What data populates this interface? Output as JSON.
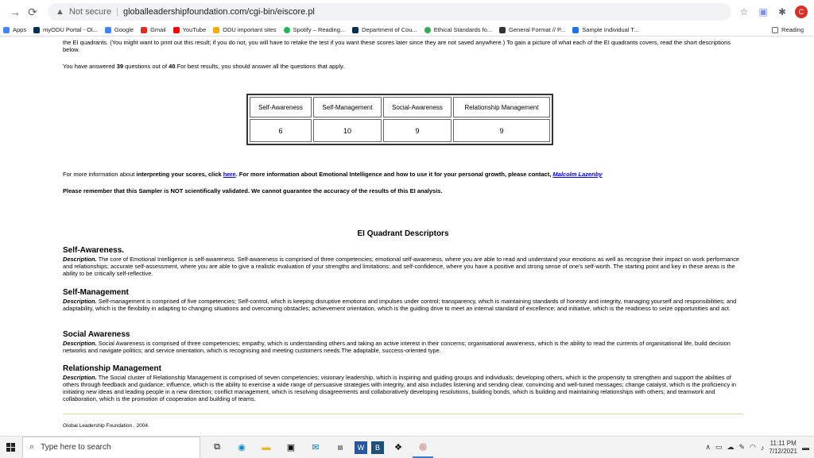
{
  "browser": {
    "security": "Not secure",
    "url": "globalleadershipfoundation.com/cgi-bin/eiscore.pl",
    "avatar_letter": "C",
    "bookmarks": [
      {
        "label": "Apps",
        "color": "#4285f4"
      },
      {
        "label": "myODU Portal - Ol...",
        "color": "#003057"
      },
      {
        "label": "Google",
        "color": "#4285f4"
      },
      {
        "label": "Gmail",
        "color": "#d93025"
      },
      {
        "label": "YouTube",
        "color": "#ff0000"
      },
      {
        "label": "ODU important sites",
        "color": "#f9ab00"
      },
      {
        "label": "Spotify – Reading...",
        "color": "#1db954"
      },
      {
        "label": "Department of Cou...",
        "color": "#003057"
      },
      {
        "label": "Ethical Standards fo...",
        "color": "#34a853"
      },
      {
        "label": "General Format // P...",
        "color": "#333333"
      },
      {
        "label": "Sample Individual T...",
        "color": "#1a73e8"
      }
    ],
    "reading_list": "Reading"
  },
  "page": {
    "intro_tail": "the EI quadrants. (You might want to print out this result; if you do not, you will have to retake the test if you want these scores later since they are not saved anywhere.) To gain a picture of what each of the EI quadrants covers, read the short descriptions below.",
    "answered_prefix": "You have answered ",
    "answered_count": "39",
    "answered_mid": " questions out of ",
    "answered_total": "40",
    "answered_suffix": ".For best results, you should answer all the questions that apply.",
    "scores": {
      "headers": [
        "Self-Awareness",
        "Self-Management",
        "Social-Awareness",
        "Relationship Management"
      ],
      "values": [
        "6",
        "10",
        "9",
        "9"
      ]
    },
    "more_info_1": "For more information about ",
    "more_info_bold": "interpreting your scores, click ",
    "more_info_link": "here",
    "more_info_2": ". For more information about Emotional Intelligence and how to use it for your personal growth, please contact, ",
    "contact_link": "Malcolm Lazenby",
    "disclaimer": "Please remember that this Sampler is NOT scientifically validated. We cannot guarantee the accuracy of the results of this EI analysis.",
    "descriptors_title": "EI Quadrant Descriptors",
    "desc_label": "Description.",
    "sections": [
      {
        "title": "Self-Awareness.",
        "text": " The core of Emotional Intelligence is self-awareness. Self-awareness is comprised of three competencies; emotional self-awareness, where you are able to read and understand your emotions as well as recognise their impact on work performance and relationships; accurate self-assessment, where you are able to give a realistic evaluation of your strengths and limitations; and self-confidence, where you have a positive and strong sense of one’s self-worth. The starting point and key in these areas is the ability to be critically self-reflective."
      },
      {
        "title": "Self-Management",
        "text": " Self-management is comprised of five competencies; Self-control, which is keeping disruptive emotions and impulses under control; transparency, which is maintaining standards of honesty and integrity, managing yourself and responsibilities; and adaptability, which is the flexibility in adapting to changing situations and overcoming obstacles; achievement orientation, which is the guiding drive to meet an internal standard of excellence; and initiative, which is the readiness to seize opportunities and act."
      },
      {
        "title": "Social Awareness",
        "text": " Social Awareness is comprised of three competencies; empathy, which is understanding others and taking an active interest in their concerns; organisational awareness, which is the ability to read the currents of organisational life, build decision networks and navigate politics; and service orientation, which is recognising and meeting customers needs.The adaptable, success-oriented type."
      },
      {
        "title": "Relationship Management",
        "text": " The Social cluster of Relationship Management is comprised of seven competencies; visionary leadership, which is inspiring and guiding groups and individuals; developing others, which is the propensity to strengthen and support the abilities of others through feedback and guidance; influence, which is the ability to exercise a wide range of persuasive strategies with integrity, and also includes listening and sending clear, convincing and well-tuned messages; change catalyst, which is the proficiency in initiating new ideas and leading people in a new direction; conflict management, which is resolving disagreements and collaboratively developing resolutions, building bonds, which is building and maintaining relationships with others; and teamwork and collaboration, which is the promotion of cooperation and building of teams."
      }
    ],
    "footer": "Global Leadership Foundation , 2004."
  },
  "taskbar": {
    "search_placeholder": "Type here to search",
    "time": "11:11 PM",
    "date": "7/12/2021"
  }
}
